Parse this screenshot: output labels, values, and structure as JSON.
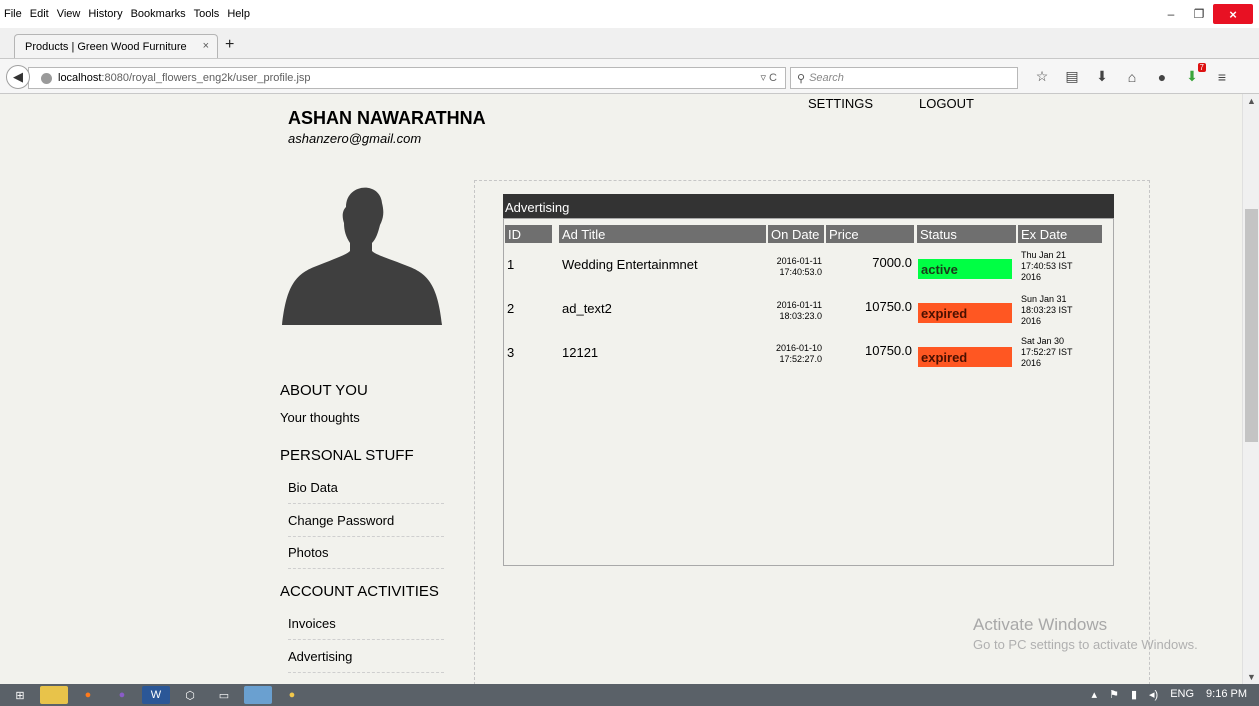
{
  "menu": [
    "File",
    "Edit",
    "View",
    "History",
    "Bookmarks",
    "Tools",
    "Help"
  ],
  "tab": {
    "title": "Products | Green Wood Furniture",
    "close": "×",
    "new": "+"
  },
  "url": {
    "host": "localhost",
    "path": ":8080/royal_flowers_eng2k/user_profile.jsp"
  },
  "search": {
    "placeholder": "Search"
  },
  "page": {
    "top_links": [
      "SETTINGS",
      "LOGOUT"
    ],
    "user_name": "ASHAN NAWARATHNA",
    "user_email": "ashanzero@gmail.com",
    "about_heading": "ABOUT YOU",
    "thoughts": "Your thoughts",
    "personal_heading": "PERSONAL STUFF",
    "personal_items": [
      "Bio Data",
      "Change Password",
      "Photos"
    ],
    "account_heading": "ACCOUNT ACTIVITIES",
    "account_items": [
      "Invoices",
      "Advertising"
    ]
  },
  "ads": {
    "title": "Advertising",
    "headers": [
      "ID",
      "Ad Title",
      "On Date",
      "Price",
      "Status",
      "Ex Date"
    ],
    "rows": [
      {
        "id": "1",
        "title": "Wedding Entertainmnet",
        "on_date": "2016-01-11",
        "on_time": "17:40:53.0",
        "price": "7000.0",
        "status": "active",
        "ex1": "Thu Jan 21",
        "ex2": "17:40:53 IST",
        "ex3": "2016"
      },
      {
        "id": "2",
        "title": "ad_text2",
        "on_date": "2016-01-11",
        "on_time": "18:03:23.0",
        "price": "10750.0",
        "status": "expired",
        "ex1": "Sun Jan 31",
        "ex2": "18:03:23 IST",
        "ex3": "2016"
      },
      {
        "id": "3",
        "title": "12121",
        "on_date": "2016-01-10",
        "on_time": "17:52:27.0",
        "price": "10750.0",
        "status": "expired",
        "ex1": "Sat Jan 30",
        "ex2": "17:52:27 IST",
        "ex3": "2016"
      }
    ]
  },
  "watermark": {
    "line1": "Activate Windows",
    "line2": "Go to PC settings to activate Windows."
  },
  "tray": {
    "lang": "ENG",
    "time": "9:16 PM"
  },
  "colors": {
    "active": "#00ff44",
    "expired": "#ff5722",
    "header": "#333333"
  }
}
